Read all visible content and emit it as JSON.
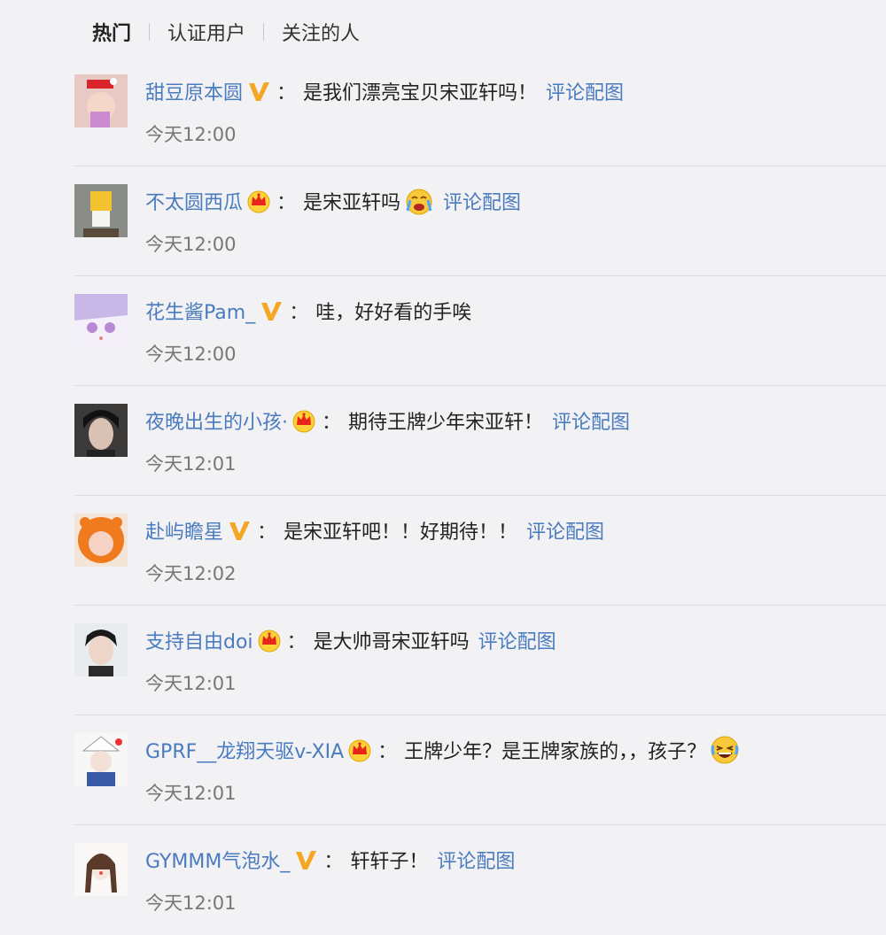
{
  "tabs": [
    {
      "label": "热门",
      "active": true
    },
    {
      "label": "认证用户",
      "active": false
    },
    {
      "label": "关注的人",
      "active": false
    }
  ],
  "colors": {
    "username": "#4a7bbf",
    "background": "#f2f2f5",
    "vip_v": "#f5a623",
    "crown": "#e8251b"
  },
  "comments": [
    {
      "username": "甜豆原本圆",
      "badge": "v-badge-icon",
      "colon": "：",
      "text": "是我们漂亮宝贝宋亚轩吗！",
      "emoji": null,
      "pic_link": "评论配图",
      "time": "今天12:00",
      "avatar": "avatar-pink-hat"
    },
    {
      "username": "不太圆西瓜",
      "badge": "crown-badge-icon",
      "colon": "：",
      "text": "是宋亚轩吗",
      "emoji": "crying-emoji-icon",
      "pic_link": "评论配图",
      "time": "今天12:00",
      "avatar": "avatar-cartoon-yellow"
    },
    {
      "username": "花生酱Pam_",
      "badge": "v-badge-icon",
      "colon": "：",
      "text": "哇，好好看的手唉",
      "emoji": null,
      "pic_link": null,
      "time": "今天12:00",
      "avatar": "avatar-anime-purple"
    },
    {
      "username": "夜晚出生的小孩·",
      "badge": "crown-badge-icon",
      "colon": "：",
      "text": "期待王牌少年宋亚轩！",
      "emoji": null,
      "pic_link": "评论配图",
      "time": "今天12:01",
      "avatar": "avatar-dark-hair"
    },
    {
      "username": "赴屿瞻星",
      "badge": "v-badge-icon",
      "colon": "：",
      "text": "是宋亚轩吧！！好期待！！",
      "emoji": null,
      "pic_link": "评论配图",
      "time": "今天12:02",
      "avatar": "avatar-orange-costume"
    },
    {
      "username": "支持自由doi",
      "badge": "crown-badge-icon",
      "colon": "：",
      "text": "是大帅哥宋亚轩吗",
      "emoji": null,
      "pic_link": "评论配图",
      "time": "今天12:01",
      "avatar": "avatar-portrait"
    },
    {
      "username": "GPRF__龙翔天驱v-XIA",
      "badge": "crown-badge-icon",
      "colon": "：",
      "text": "王牌少年？是王牌家族的，，孩子？",
      "emoji": "laughing-emoji-icon",
      "pic_link": null,
      "time": "今天12:01",
      "avatar": "avatar-white-hat"
    },
    {
      "username": "GYMMM气泡水_",
      "badge": "v-badge-icon",
      "colon": "：",
      "text": "轩轩子！",
      "emoji": null,
      "pic_link": "评论配图",
      "time": "今天12:01",
      "avatar": "avatar-sketch-girl"
    }
  ]
}
